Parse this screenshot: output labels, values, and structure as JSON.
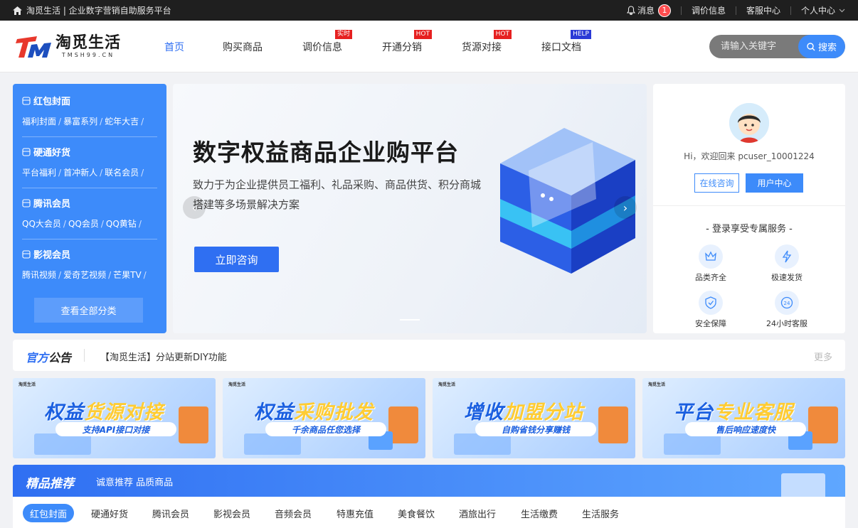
{
  "topbar": {
    "site_title": "淘觅生活 | 企业数字营销自助服务平台",
    "messages_label": "消息",
    "messages_count": "1",
    "price_info": "调价信息",
    "customer_service": "客服中心",
    "personal_center": "个人中心"
  },
  "logo": {
    "cn": "淘觅生活",
    "en": "TMSH99.CN"
  },
  "nav": {
    "items": [
      {
        "label": "首页"
      },
      {
        "label": "购买商品"
      },
      {
        "label": "调价信息",
        "tag": "实时"
      },
      {
        "label": "开通分销",
        "tag": "HOT"
      },
      {
        "label": "货源对接",
        "tag": "HOT"
      },
      {
        "label": "接口文档",
        "tag": "HELP"
      }
    ]
  },
  "search": {
    "placeholder": "请输入关键字",
    "button": "搜索"
  },
  "categories": [
    {
      "title": "红包封面",
      "links": [
        "福利封面",
        "暴富系列",
        "蛇年大吉"
      ]
    },
    {
      "title": "硬通好货",
      "links": [
        "平台福利",
        "首冲新人",
        "联名会员"
      ]
    },
    {
      "title": "腾讯会员",
      "links": [
        "QQ大会员",
        "QQ会员",
        "QQ黄钻"
      ]
    },
    {
      "title": "影视会员",
      "links": [
        "腾讯视频",
        "爱奇艺视频",
        "芒果TV"
      ]
    }
  ],
  "view_all": "查看全部分类",
  "banner": {
    "title": "数字权益商品企业购平台",
    "desc": "致力于为企业提供员工福利、礼品采购、商品供货、积分商城搭建等多场景解决方案",
    "button": "立即咨询"
  },
  "user": {
    "greeting": "Hi，欢迎回来 pcuser_10001224",
    "consult": "在线咨询",
    "center": "用户中心",
    "service_title": "- 登录享受专属服务 -",
    "services": [
      "品类齐全",
      "极速发货",
      "安全保障",
      "24小时客服"
    ]
  },
  "notice": {
    "title_a": "官方",
    "title_b": "公告",
    "content": "【淘觅生活】分站更新DIY功能",
    "more": "更多"
  },
  "promos": [
    {
      "logo": "淘觅生活",
      "title_a": "权益",
      "title_b": "货源对接",
      "sub": "支持API接口对接"
    },
    {
      "logo": "淘觅生活",
      "title_a": "权益",
      "title_b": "采购批发",
      "sub": "千余商品任您选择"
    },
    {
      "logo": "淘觅生活",
      "title_a": "增收",
      "title_b": "加盟分站",
      "sub": "自购省钱分享赚钱"
    },
    {
      "logo": "淘觅生活",
      "title_a": "平台",
      "title_b": "专业客服",
      "sub": "售后响应速度快"
    }
  ],
  "recommend": {
    "title": "精品推荐",
    "subtitle": "诚意推荐 品质商品",
    "tabs": [
      "红包封面",
      "硬通好货",
      "腾讯会员",
      "影视会员",
      "音频会员",
      "特惠充值",
      "美食餐饮",
      "酒旅出行",
      "生活缴费",
      "生活服务"
    ]
  }
}
